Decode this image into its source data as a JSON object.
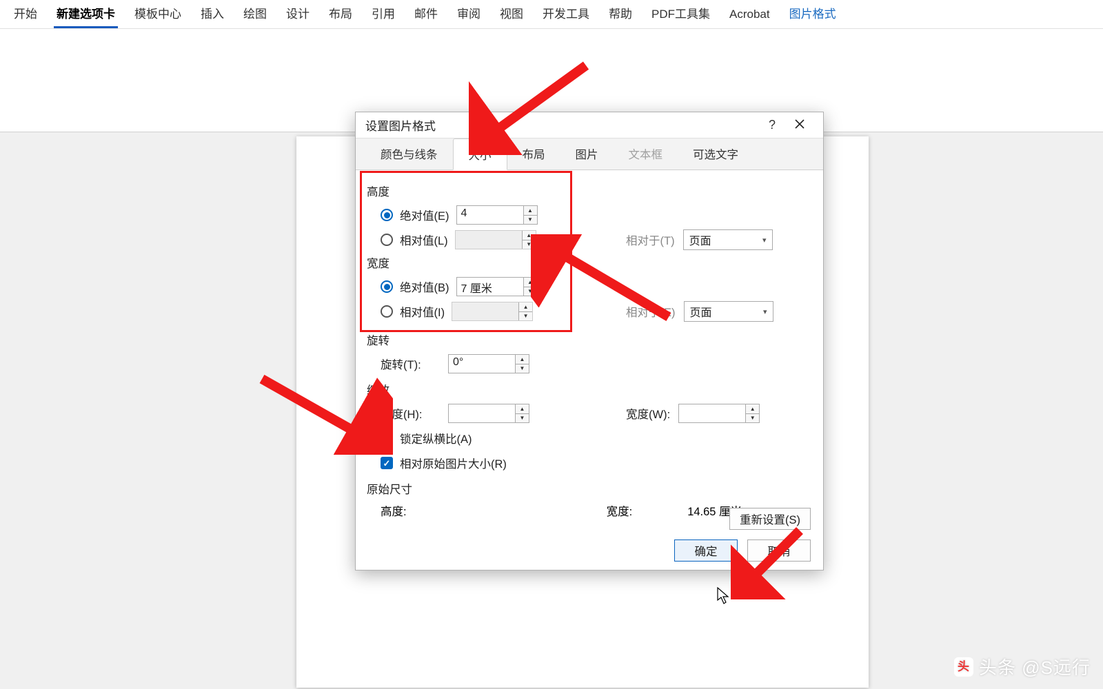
{
  "ribbon": {
    "tabs": [
      "开始",
      "新建选项卡",
      "模板中心",
      "插入",
      "绘图",
      "设计",
      "布局",
      "引用",
      "邮件",
      "审阅",
      "视图",
      "开发工具",
      "帮助",
      "PDF工具集",
      "Acrobat",
      "图片格式"
    ],
    "selected": "新建选项卡",
    "context": "图片格式"
  },
  "dialog": {
    "title": "设置图片格式",
    "help": "?",
    "tabs": {
      "colors": "颜色与线条",
      "size": "大小",
      "layout": "布局",
      "picture": "图片",
      "textbox": "文本框",
      "alttext": "可选文字"
    },
    "height_group": "高度",
    "width_group": "宽度",
    "abs_e": "绝对值(E)",
    "rel_l": "相对值(L)",
    "abs_b": "绝对值(B)",
    "rel_i": "相对值(I)",
    "height_abs_val": "4",
    "width_abs_val": "7 厘米",
    "relative_to_t": "相对于(T)",
    "relative_to_e": "相对于(E)",
    "page_option": "页面",
    "rotation_group": "旋转",
    "rotation_label": "旋转(T):",
    "rotation_val": "0°",
    "scale_group": "缩放",
    "scale_h": "高度(H):",
    "scale_w": "宽度(W):",
    "lock_aspect": "锁定纵横比(A)",
    "rel_orig": "相对原始图片大小(R)",
    "orig_group": "原始尺寸",
    "orig_h_label": "高度:",
    "orig_w_label": "宽度:",
    "orig_w_val": "14.65 厘米",
    "reset": "重新设置(S)",
    "ok": "确定",
    "cancel": "取消"
  },
  "watermark": "头条 @S远行"
}
